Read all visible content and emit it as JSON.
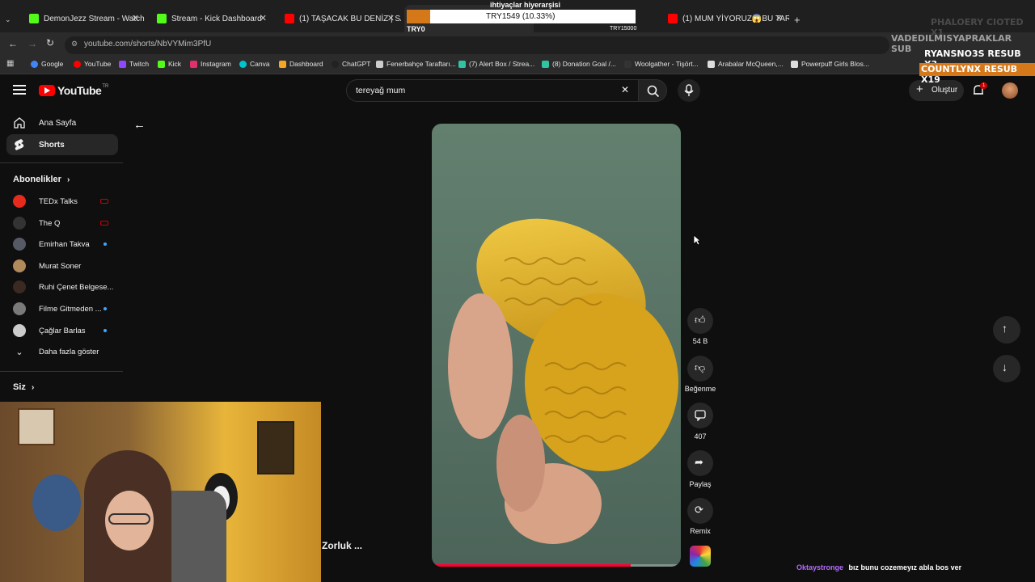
{
  "browser": {
    "tabs": [
      {
        "title": "DemonJezz Stream - Watch Live",
        "icon": "kick-icon",
        "color": "#53fc18"
      },
      {
        "title": "Stream - Kick Dashboard",
        "icon": "kick-icon",
        "color": "#53fc18"
      },
      {
        "title": "(1) TAŞACAK BU DENİZ | SAY T",
        "icon": "youtube-icon",
        "color": "#ff0000"
      },
      {
        "title": "(1) MUM YİYORUZ😱BU TARİF",
        "icon": "youtube-icon",
        "color": "#ff0000"
      }
    ],
    "url": "youtube.com/shorts/NbVYMim3PfU",
    "bookmarks": [
      {
        "label": "Google",
        "color": "#4285f4"
      },
      {
        "label": "YouTube",
        "color": "#ff0000"
      },
      {
        "label": "Twitch",
        "color": "#9146ff"
      },
      {
        "label": "Kick",
        "color": "#53fc18"
      },
      {
        "label": "Instagram",
        "color": "#e1306c"
      },
      {
        "label": "Canva",
        "color": "#00c4cc"
      },
      {
        "label": "Dashboard",
        "color": "#f5a623"
      },
      {
        "label": "ChatGPT",
        "color": "#222222"
      },
      {
        "label": "Fenerbahçe Taraftarı...",
        "color": "#cccccc"
      },
      {
        "label": "(7) Alert Box / Strea...",
        "color": "#31c3a2"
      },
      {
        "label": "(8) Donation Goal /...",
        "color": "#31c3a2"
      },
      {
        "label": "Woolgather - Tişört...",
        "color": "#333333"
      },
      {
        "label": "Arabalar McQueen,...",
        "color": "#dddddd"
      },
      {
        "label": "Powerpuff Girls Blos...",
        "color": "#dddddd"
      }
    ]
  },
  "youtube": {
    "logo": "YouTube",
    "region": "TR",
    "search_value": "tereyağ mum",
    "create_label": "Oluştur",
    "notification_count": "1"
  },
  "sidebar": {
    "nav": [
      {
        "label": "Ana Sayfa",
        "icon": "home-icon"
      },
      {
        "label": "Shorts",
        "icon": "shorts-icon"
      }
    ],
    "subscriptions_title": "Abonelikler",
    "channels": [
      {
        "name": "TEDx Talks",
        "status": "live"
      },
      {
        "name": "The Q",
        "status": "live"
      },
      {
        "name": "Emirhan Takva",
        "status": "new"
      },
      {
        "name": "Murat Soner",
        "status": ""
      },
      {
        "name": "Ruhi Çenet Belgese...",
        "status": ""
      },
      {
        "name": "Filme Gitmeden ...",
        "status": "new"
      },
      {
        "name": "Çağlar Barlas",
        "status": "new"
      }
    ],
    "show_more": "Daha fazla göster",
    "you_label": "Siz"
  },
  "short": {
    "likes": "54 B",
    "dislike_label": "Beğenme",
    "comments": "407",
    "share_label": "Paylaş",
    "remix_label": "Remix",
    "channel_partial": "Zorluk ...",
    "progress": 0.8
  },
  "overlays": {
    "donation_title": "ihtiyaçlar hiyerarşisi",
    "donation_amount": "TRY1549 (10.33%)",
    "donation_start": "TRY0",
    "donation_goal": "TRY15000",
    "donation_fraction": 0.1033,
    "sub_lines": [
      "PHALOERY   CIOTED X1",
      "VADEDILMISYAPRAKLAR  SUB",
      "RYANSNO3S  RESUB X3",
      "COUNTLYNX  RESUB X19"
    ],
    "chat_user": "Oktaystronge",
    "chat_message": "bız bunu cozemeyız abla bos ver"
  }
}
